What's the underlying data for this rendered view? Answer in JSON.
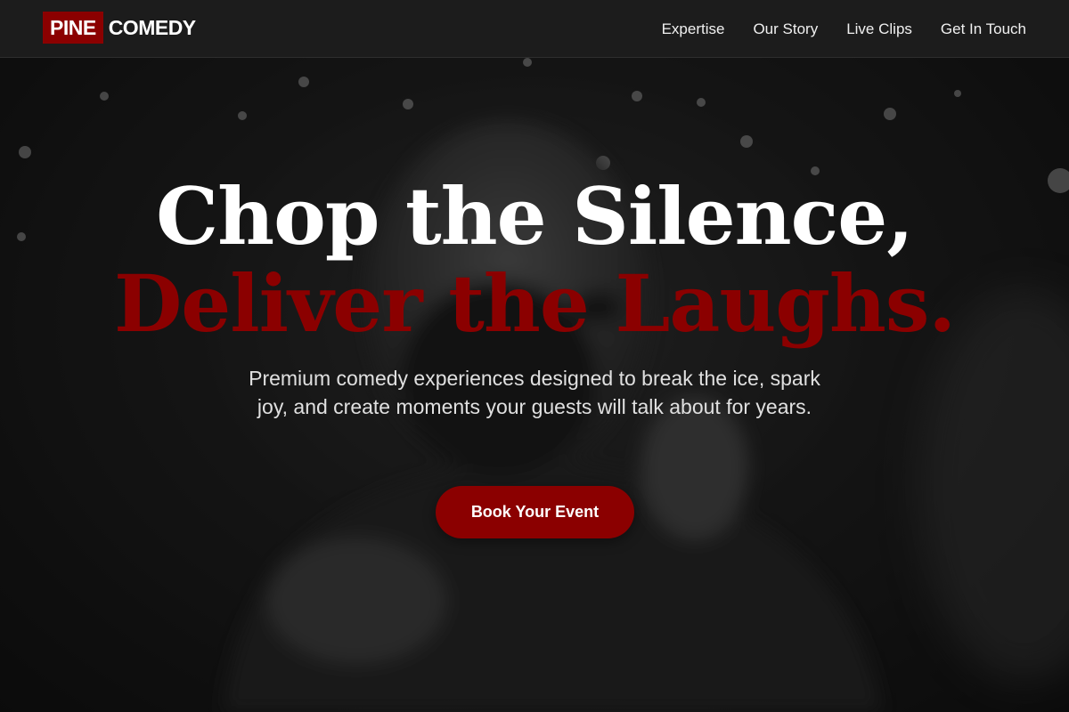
{
  "brand": {
    "logo_box_text": "PINE",
    "logo_word_text": "COMEDY",
    "accent_color": "#8b0000"
  },
  "nav": {
    "links": [
      {
        "label": "Expertise"
      },
      {
        "label": "Our Story"
      },
      {
        "label": "Live Clips"
      },
      {
        "label": "Get In Touch"
      }
    ]
  },
  "hero": {
    "headline_line_1": "Chop the Silence,",
    "headline_line_2": "Deliver the Laughs.",
    "subtitle": "Premium comedy experiences designed to break the ice, spark joy, and create moments your guests will talk about for years.",
    "cta_label": "Book Your Event",
    "background_image": "black-and-white-photo-comedian-with-microphone"
  }
}
